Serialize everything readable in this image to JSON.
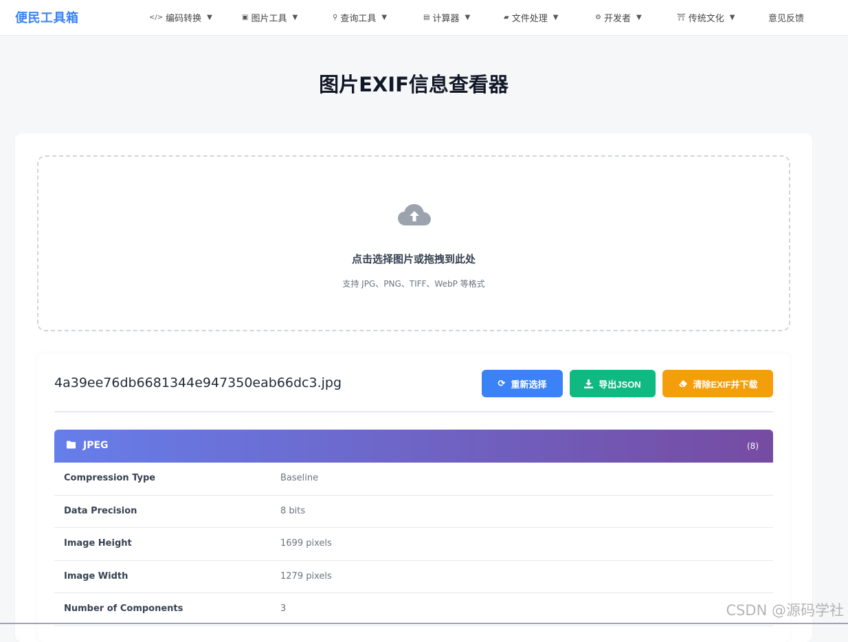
{
  "brand": "便民工具箱",
  "nav": [
    {
      "label": "编码转换",
      "icon": "code-icon",
      "glyph": "</>",
      "dropdown": true
    },
    {
      "label": "图片工具",
      "icon": "image-icon",
      "glyph": "▣",
      "dropdown": true
    },
    {
      "label": "查询工具",
      "icon": "search-icon",
      "glyph": "⚲",
      "dropdown": true
    },
    {
      "label": "计算器",
      "icon": "calculator-icon",
      "glyph": "▤",
      "dropdown": true
    },
    {
      "label": "文件处理",
      "icon": "folder-open-icon",
      "glyph": "▰",
      "dropdown": true
    },
    {
      "label": "开发者",
      "icon": "gear-icon",
      "glyph": "⚙",
      "dropdown": true
    },
    {
      "label": "传统文化",
      "icon": "landmark-icon",
      "glyph": "⛩",
      "dropdown": true
    },
    {
      "label": "意见反馈",
      "icon": "",
      "glyph": "",
      "dropdown": false
    }
  ],
  "page_title": "图片EXIF信息查看器",
  "dropzone": {
    "icon": "cloud-upload-icon",
    "title": "点击选择图片或拖拽到此处",
    "hint": "支持 JPG、PNG、TIFF、WebP 等格式"
  },
  "result": {
    "file_name": "4a39ee76db6681344e947350eab66dc3.jpg",
    "buttons": {
      "reselect": "重新选择",
      "export": "导出JSON",
      "clean": "清除EXIF并下载"
    },
    "section": {
      "name": "JPEG",
      "count": "(8)",
      "rows": [
        {
          "key": "Compression Type",
          "value": "Baseline"
        },
        {
          "key": "Data Precision",
          "value": "8 bits"
        },
        {
          "key": "Image Height",
          "value": "1699 pixels"
        },
        {
          "key": "Image Width",
          "value": "1279 pixels"
        },
        {
          "key": "Number of Components",
          "value": "3"
        }
      ]
    }
  },
  "watermark": "CSDN @源码学社",
  "colors": {
    "brand": "#3b82f6",
    "reselect": "#3b82f6",
    "export": "#10b981",
    "clean": "#f59e0b",
    "section_gradient_start": "#667eea",
    "section_gradient_end": "#764ba2"
  }
}
